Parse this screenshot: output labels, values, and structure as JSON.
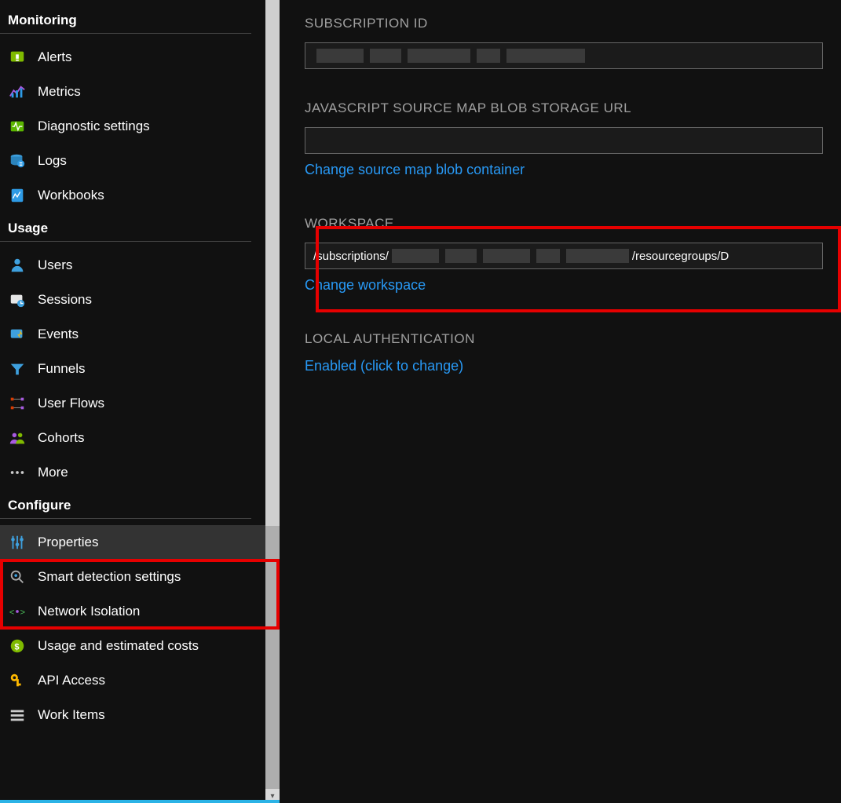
{
  "sidebar": {
    "sections": [
      {
        "title": "Monitoring",
        "items": [
          {
            "label": "Alerts",
            "icon": "alerts-icon"
          },
          {
            "label": "Metrics",
            "icon": "metrics-icon"
          },
          {
            "label": "Diagnostic settings",
            "icon": "diagnostic-icon"
          },
          {
            "label": "Logs",
            "icon": "logs-icon"
          },
          {
            "label": "Workbooks",
            "icon": "workbooks-icon"
          }
        ]
      },
      {
        "title": "Usage",
        "items": [
          {
            "label": "Users",
            "icon": "users-icon"
          },
          {
            "label": "Sessions",
            "icon": "sessions-icon"
          },
          {
            "label": "Events",
            "icon": "events-icon"
          },
          {
            "label": "Funnels",
            "icon": "funnels-icon"
          },
          {
            "label": "User Flows",
            "icon": "userflows-icon"
          },
          {
            "label": "Cohorts",
            "icon": "cohorts-icon"
          },
          {
            "label": "More",
            "icon": "more-icon"
          }
        ]
      },
      {
        "title": "Configure",
        "items": [
          {
            "label": "Properties",
            "icon": "properties-icon",
            "selected": true
          },
          {
            "label": "Smart detection settings",
            "icon": "smartdetect-icon"
          },
          {
            "label": "Network Isolation",
            "icon": "network-icon"
          },
          {
            "label": "Usage and estimated costs",
            "icon": "costs-icon"
          },
          {
            "label": "API Access",
            "icon": "apikey-icon"
          },
          {
            "label": "Work Items",
            "icon": "workitems-icon"
          }
        ]
      }
    ]
  },
  "main": {
    "subscription_id_label": "SUBSCRIPTION ID",
    "sourcemap_label": "JAVASCRIPT SOURCE MAP BLOB STORAGE URL",
    "sourcemap_link": "Change source map blob container",
    "workspace_label": "WORKSPACE",
    "workspace_prefix": "/subscriptions/",
    "workspace_suffix": "/resourcegroups/D",
    "workspace_link": "Change workspace",
    "localauth_label": "LOCAL AUTHENTICATION",
    "localauth_link": "Enabled (click to change)"
  }
}
